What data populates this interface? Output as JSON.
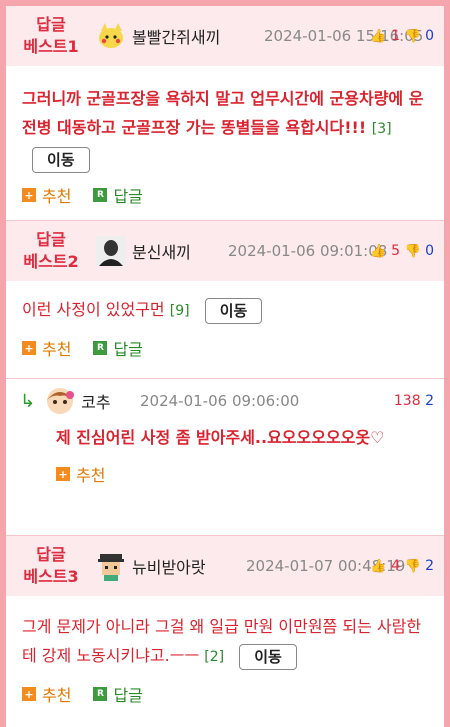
{
  "comments": [
    {
      "badge_line1": "답글",
      "badge_line2": "베스트1",
      "nick": "볼빨간쥐새끼",
      "date": "2024-01-06 15:16:05",
      "up": "1",
      "down": "0",
      "text": "그러니까 군골프장을 욕하지 말고 업무시간에 군용차량에 운전병 대동하고 군골프장 가는 똥별들을 욕합시다!!!",
      "reply_count": "[3]",
      "move_label": "이동",
      "recommend_label": "추천",
      "reply_label": "답글"
    },
    {
      "badge_line1": "답글",
      "badge_line2": "베스트2",
      "nick": "분신새끼",
      "date": "2024-01-06 09:01:08",
      "up": "5",
      "down": "0",
      "text": "이런 사정이 있었구먼",
      "reply_count": "[9]",
      "move_label": "이동",
      "recommend_label": "추천",
      "reply_label": "답글"
    },
    {
      "badge_line1": "답글",
      "badge_line2": "베스트3",
      "nick": "뉴비받아랏",
      "date": "2024-01-07 00:48:19",
      "up": "4",
      "down": "2",
      "text": "그게 문제가 아니라 그걸 왜 일급 만원 이만원쯤 되는 사람한테 강제 노동시키냐고.ㅡㅡ",
      "reply_count": "[2]",
      "move_label": "이동",
      "recommend_label": "추천",
      "reply_label": "답글"
    }
  ],
  "reply": {
    "nick": "코추",
    "date": "2024-01-06 09:06:00",
    "up": "138",
    "down": "2",
    "text": "제 진심어린 사정 좀 받아주세..요오오오오오옷♡",
    "recommend_label": "추천"
  },
  "colors": {
    "accent": "#e02a3f",
    "page_bg": "#f7a5ad",
    "header_bg": "#fdeaec"
  }
}
